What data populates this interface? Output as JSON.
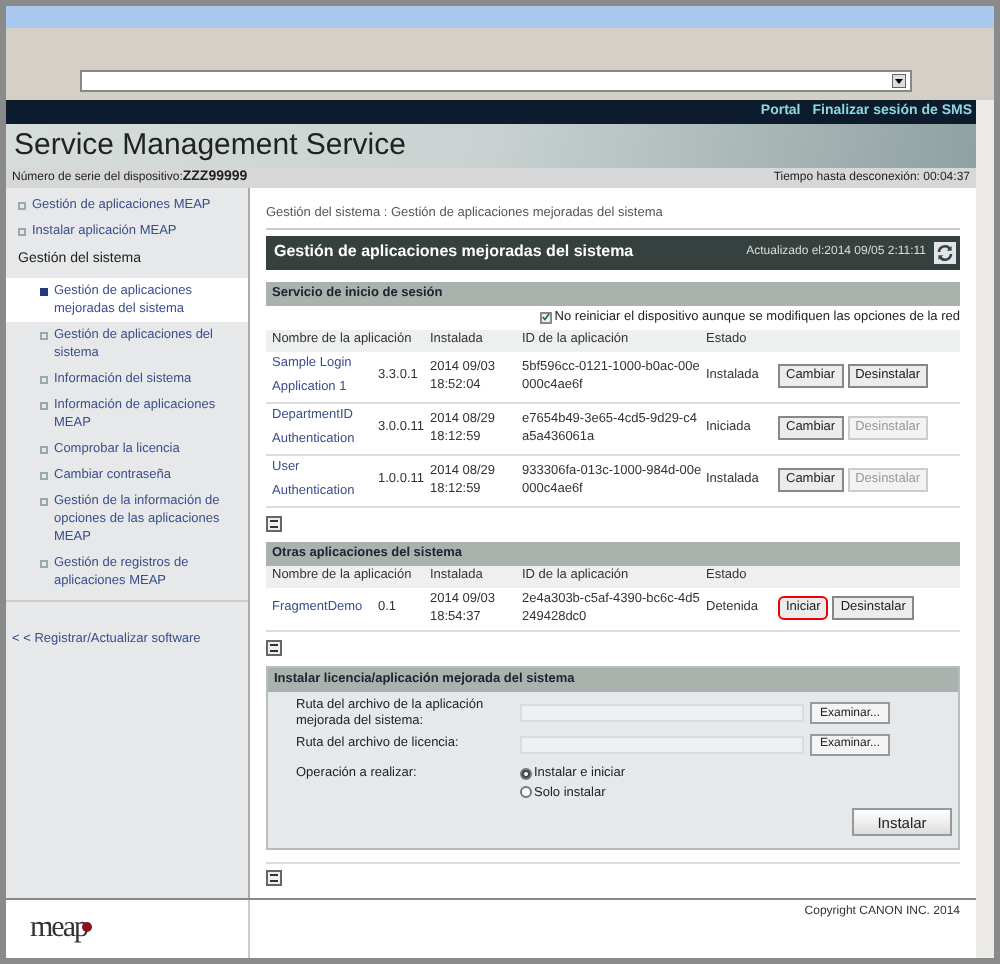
{
  "header": {
    "links": [
      "Portal",
      "Finalizar sesión de SMS"
    ],
    "title": "Service Management Service",
    "serial_label": "Número de serie del dispositivo:",
    "serial": "ZZZ99999",
    "timeout": "Tiempo hasta desconexión: 00:04:37"
  },
  "sidebar": {
    "items": [
      {
        "label": "Gestión de aplicaciones MEAP",
        "kind": "link"
      },
      {
        "label": "Instalar aplicación MEAP",
        "kind": "link"
      },
      {
        "label": "Gestión del sistema",
        "kind": "section",
        "children": [
          {
            "label": "Gestión de aplicaciones mejoradas del sistema",
            "selected": true
          },
          {
            "label": "Gestión de aplicaciones del sistema",
            "selected": false
          },
          {
            "label": "Información del sistema",
            "selected": false
          },
          {
            "label": "Información de aplicaciones MEAP",
            "selected": false
          },
          {
            "label": "Comprobar la licencia",
            "selected": false
          },
          {
            "label": "Cambiar contraseña",
            "selected": false
          },
          {
            "label": "Gestión de la información de opciones de las aplicaciones MEAP",
            "selected": false
          },
          {
            "label": "Gestión de registros de aplicaciones MEAP",
            "selected": false
          }
        ]
      }
    ],
    "back_link": "< < Registrar/Actualizar software"
  },
  "breadcrumb": "Gestión del sistema : Gestión de aplicaciones mejoradas del sistema",
  "page_title": "Gestión de aplicaciones mejoradas del sistema",
  "updated": "Actualizado el:2014 09/05 2:11:11",
  "login_service": {
    "title": "Servicio de inicio de sesión",
    "option": {
      "label": "No reiniciar el dispositivo aunque se modifiquen las opciones de la red",
      "checked": true
    },
    "columns": [
      "Nombre de la aplicación",
      "Instalada",
      "ID de la aplicación",
      "Estado"
    ],
    "rows": [
      {
        "name": "Sample Login Application 1",
        "version": "3.3.0.1",
        "installed": "2014 09/03 18:52:04",
        "id": "5bf596cc-0121-1000-b0ac-00e000c4ae6f",
        "status": "Instalada",
        "buttons": [
          {
            "label": "Cambiar",
            "disabled": false
          },
          {
            "label": "Desinstalar",
            "disabled": false
          }
        ]
      },
      {
        "name": "DepartmentID Authentication",
        "version": "3.0.0.11",
        "installed": "2014 08/29 18:12:59",
        "id": "e7654b49-3e65-4cd5-9d29-c4a5a436061a",
        "status": "Iniciada",
        "buttons": [
          {
            "label": "Cambiar",
            "disabled": false
          },
          {
            "label": "Desinstalar",
            "disabled": true
          }
        ]
      },
      {
        "name": "User Authentication",
        "version": "1.0.0.11",
        "installed": "2014 08/29 18:12:59",
        "id": "933306fa-013c-1000-984d-00e000c4ae6f",
        "status": "Instalada",
        "buttons": [
          {
            "label": "Cambiar",
            "disabled": false
          },
          {
            "label": "Desinstalar",
            "disabled": true
          }
        ]
      }
    ]
  },
  "other_apps": {
    "title": "Otras aplicaciones del sistema",
    "columns": [
      "Nombre de la aplicación",
      "Instalada",
      "ID de la aplicación",
      "Estado"
    ],
    "rows": [
      {
        "name": "FragmentDemo",
        "version": "0.1",
        "installed": "2014 09/03 18:54:37",
        "id": "2e4a303b-c5af-4390-bc6c-4d5249428dc0",
        "status": "Detenida",
        "buttons": [
          {
            "label": "Iniciar",
            "disabled": false,
            "highlighted": true
          },
          {
            "label": "Desinstalar",
            "disabled": false,
            "highlighted": false
          }
        ]
      }
    ]
  },
  "install": {
    "title": "Instalar licencia/aplicación mejorada del sistema",
    "fields": [
      {
        "label": "Ruta del archivo de la aplicación mejorada del sistema:",
        "button": "Examinar..."
      },
      {
        "label": "Ruta del archivo de licencia:",
        "button": "Examinar..."
      }
    ],
    "operation_label": "Operación a realizar:",
    "options": [
      {
        "label": "Instalar e iniciar",
        "selected": true
      },
      {
        "label": "Solo instalar",
        "selected": false
      }
    ],
    "submit": "Instalar"
  },
  "footer": {
    "logo": "meap",
    "copyright": "Copyright CANON INC. 2014"
  }
}
